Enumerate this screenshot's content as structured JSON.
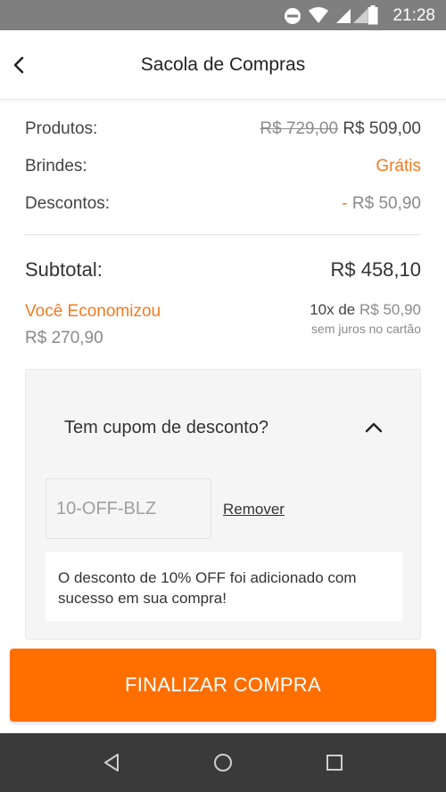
{
  "status_bar": {
    "time": "21:28",
    "icons": [
      "do-not-disturb-icon",
      "wifi-icon",
      "signal-icon",
      "battery-icon"
    ]
  },
  "header": {
    "title": "Sacola de Compras",
    "back_icon": "chevron-left-icon"
  },
  "summary": {
    "products_label": "Produtos:",
    "products_old_price": "R$ 729,00",
    "products_price": "R$ 509,00",
    "gifts_label": "Brindes:",
    "gifts_value": "Grátis",
    "discounts_label": "Descontos:",
    "discounts_sign": "-",
    "discounts_value": "R$ 50,90",
    "subtotal_label": "Subtotal:",
    "subtotal_value": "R$ 458,10",
    "saved_label": "Você Economizou",
    "saved_value": "R$ 270,90",
    "installments_prefix": "10x de",
    "installments_value": "R$ 50,90",
    "installments_note": "sem juros no cartão"
  },
  "coupon": {
    "question": "Tem cupom de desconto?",
    "code": "10-OFF-BLZ",
    "remove_label": "Remover",
    "message": "O desconto de 10% OFF foi adicionado com sucesso em sua compra!"
  },
  "cta": {
    "label": "FINALIZAR COMPRA"
  },
  "nav_bar": {
    "icons": [
      "back-triangle-icon",
      "home-circle-icon",
      "recents-square-icon"
    ]
  },
  "colors": {
    "accent": "#ff6f00",
    "orange_text": "#f47a1f",
    "status_bar": "#7f7f7f",
    "nav_bar": "#3a3a3a"
  }
}
